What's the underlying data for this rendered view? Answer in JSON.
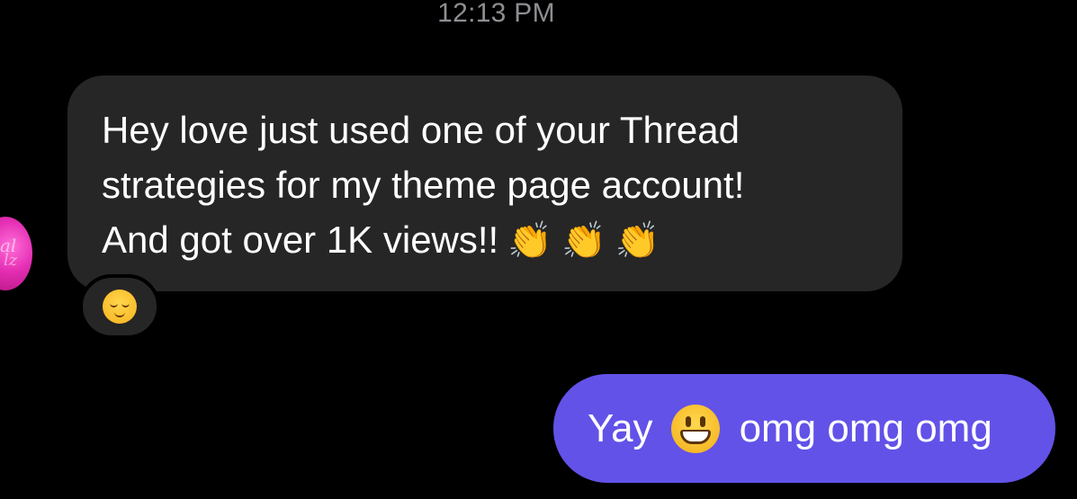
{
  "conversation": {
    "timestamp": "12:13 PM",
    "incoming_message": {
      "lines": [
        "Hey love just used one of your Thread",
        "strategies for my theme page account!",
        "And got over 1K views!!"
      ],
      "trailing_emoji": [
        "👏",
        "👏",
        "👏"
      ],
      "reaction_emoji_name": "relieved-face-icon"
    },
    "outgoing_message": {
      "text_before_emoji": "Yay",
      "emoji_name": "grinning-face-icon",
      "text_after_emoji": "omg omg omg"
    }
  },
  "colors": {
    "background": "#000000",
    "incoming_bubble": "#262626",
    "outgoing_bubble": "#6252e8",
    "timestamp_text": "#8e8e93",
    "avatar_gradient": "#e52fb5"
  }
}
